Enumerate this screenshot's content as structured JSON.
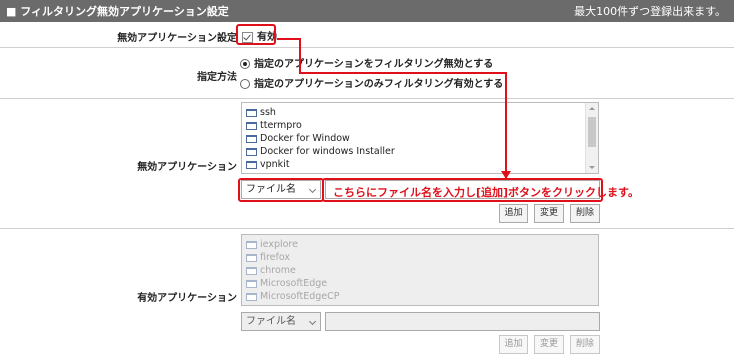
{
  "header": {
    "title": "■ フィルタリング無効アプリケーション設定",
    "note": "最大100件ずつ登録出来ます。"
  },
  "enable_row": {
    "label": "無効アプリケーション設定",
    "checkbox_label": "有効",
    "checked": true
  },
  "method_row": {
    "label": "指定方法",
    "options": [
      {
        "label": "指定のアプリケーションをフィルタリング無効とする",
        "selected": true
      },
      {
        "label": "指定のアプリケーションのみフィルタリング有効とする",
        "selected": false
      }
    ]
  },
  "disabled_apps": {
    "label": "無効アプリケーション",
    "items": [
      "ssh",
      "ttermpro",
      "Docker for Window",
      "Docker for windows Installer",
      "vpnkit"
    ],
    "select_value": "ファイル名",
    "input_value": "",
    "buttons": {
      "add": "追加",
      "change": "変更",
      "delete": "削除"
    }
  },
  "annotation": {
    "text": "こちらにファイル名を入力し[追加]ボタンをクリックします。",
    "color": "#e0101a"
  },
  "enabled_apps": {
    "label": "有効アプリケーション",
    "items": [
      "iexplore",
      "firefox",
      "chrome",
      "MicrosoftEdge",
      "MicrosoftEdgeCP"
    ],
    "select_value": "ファイル名",
    "input_value": "",
    "buttons": {
      "add": "追加",
      "change": "変更",
      "delete": "削除"
    }
  }
}
